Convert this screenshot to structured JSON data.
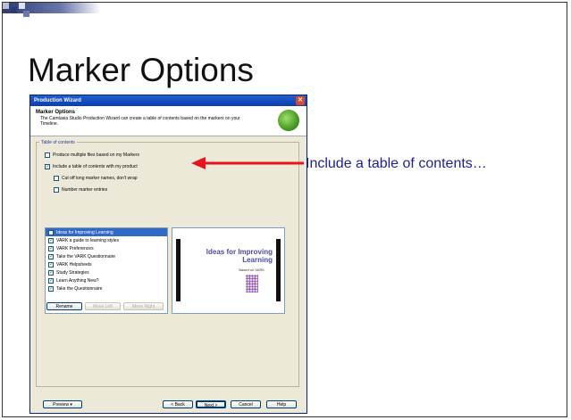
{
  "slide": {
    "title": "Marker Options",
    "callout": "Include a table of contents…"
  },
  "wizard": {
    "window_title": "Production Wizard",
    "close_glyph": "✕",
    "header_title": "Marker Options",
    "header_desc": "The Camtasia Studio Production Wizard can create a table of contents based on the markers on your Timeline.",
    "group_label": "Table of contents",
    "options": {
      "multiple_files": "Produce multiple files based on my Markers",
      "include_toc": "Include a table of contents with my product",
      "cut_off_names": "Cut off long marker names, don't wrap",
      "number_entries": "Number marker entries"
    },
    "check_glyph": "✓",
    "markers": [
      "Ideas for Improving Learning",
      "VARK a guide to learning styles",
      "VARK Preferences",
      "Take the VARK Questionnaire",
      "VARK Helpsheets",
      "Study Strategies",
      "Learn Anything New?",
      "Take the Questionnaire"
    ],
    "preview": {
      "title": "Ideas for Improving Learning",
      "subtitle": "Based on VARK"
    },
    "buttons": {
      "rename": "Rename",
      "move_left": "Move Left",
      "move_right": "Move Right",
      "preview": "Preview  ▾",
      "back": "< Back",
      "next": "Next >",
      "cancel": "Cancel",
      "help": "Help"
    }
  },
  "colors": {
    "arrow": "#e8141b",
    "callout_text": "#1f1f8f",
    "selection": "#316ac5"
  }
}
